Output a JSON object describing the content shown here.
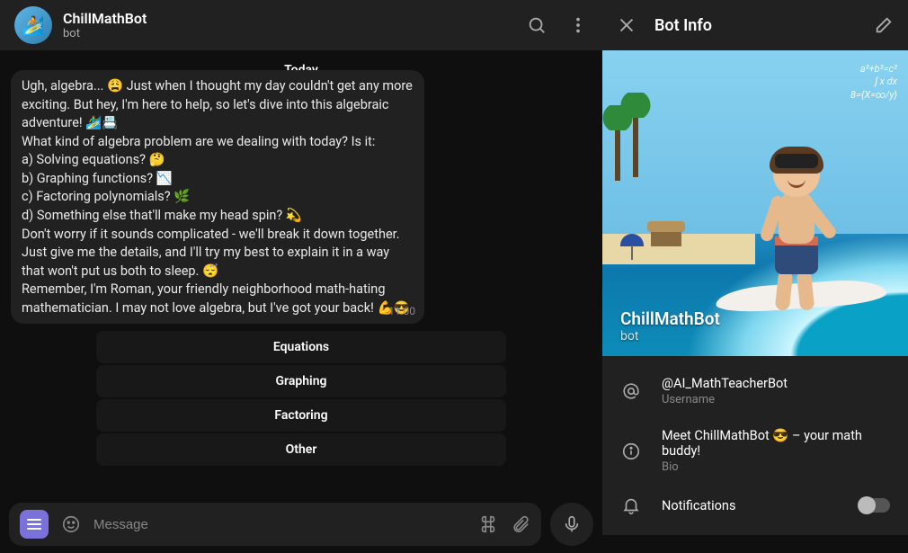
{
  "header": {
    "title": "ChillMathBot",
    "subtitle": "bot"
  },
  "chat": {
    "date_label": "Today",
    "message": {
      "line1": "Ugh, algebra... 😩 Just when I thought my day couldn't get any more exciting. But hey, I'm here to help, so let's dive into this algebraic adventure! 🏄‍♂️📇",
      "line2": "What kind of algebra problem are we dealing with today? Is it:",
      "opt_a": "a) Solving equations? 🤔",
      "opt_b": "b) Graphing functions? 📉",
      "opt_c": "c) Factoring polynomials? 🌿",
      "opt_d": "d) Something else that'll make my head spin? 💫",
      "line3": "Don't worry if it sounds complicated - we'll break it down together. Just give me the details, and I'll try my best to explain it in a way that won't put us both to sleep. 😴",
      "line4": "Remember, I'm Roman, your friendly neighborhood math-hating mathematician. I may not love algebra, but I've got your back! 💪😎",
      "time": "11:00"
    },
    "quick_replies": [
      "Equations",
      "Graphing",
      "Factoring",
      "Other"
    ],
    "composer_placeholder": "Message"
  },
  "info": {
    "panel_title": "Bot Info",
    "profile_name": "ChillMathBot",
    "profile_sub": "bot",
    "username_value": "@AI_MathTeacherBot",
    "username_label": "Username",
    "bio_value": "Meet ChillMathBot 😎 – your math buddy!",
    "bio_label": "Bio",
    "notifications_label": "Notifications"
  }
}
